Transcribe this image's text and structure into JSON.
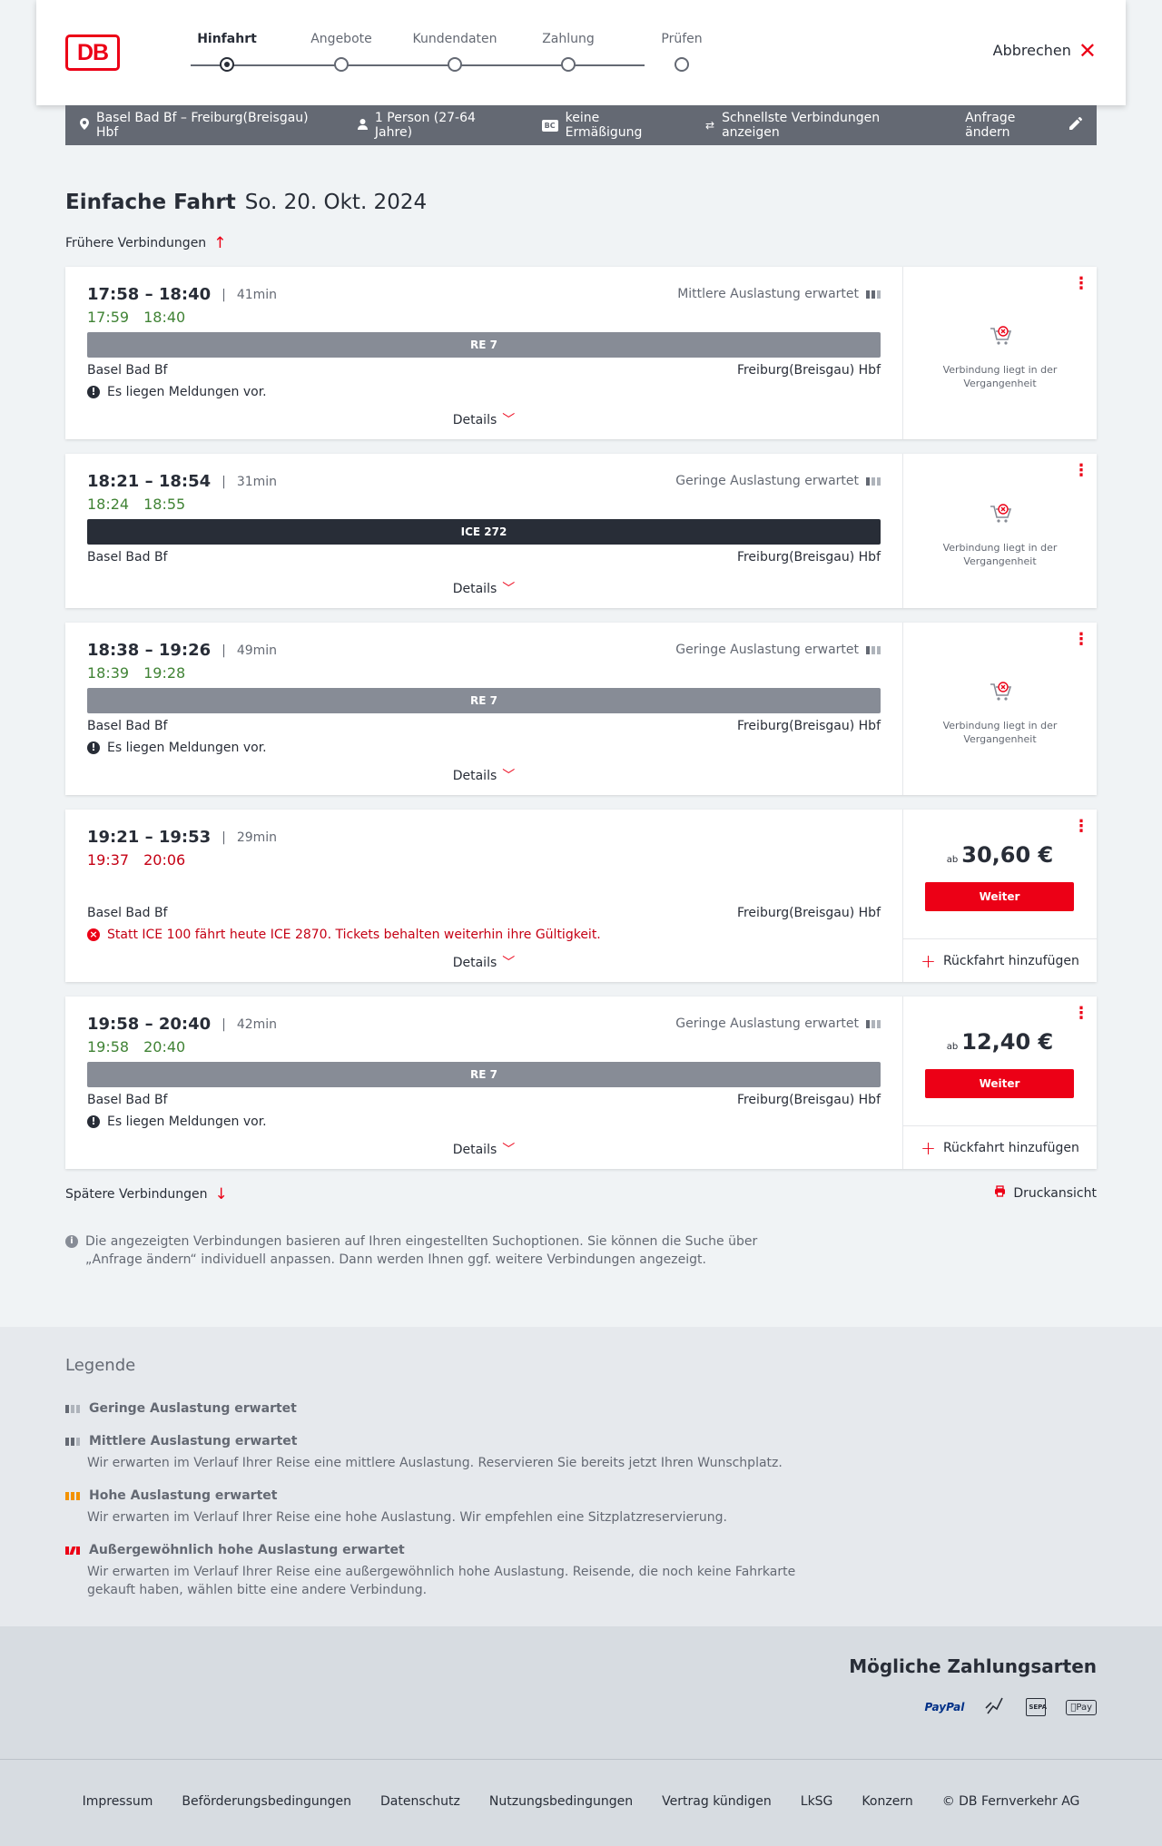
{
  "header": {
    "logo": "DB",
    "steps": [
      "Hinfahrt",
      "Angebote",
      "Kundendaten",
      "Zahlung",
      "Prüfen"
    ],
    "cancel_label": "Abbrechen"
  },
  "summary": {
    "route": "Basel Bad Bf – Freiburg(Breisgau) Hbf",
    "travellers": "1 Person (27-64 Jahre)",
    "discount": "keine Ermäßigung",
    "discount_badge": "BC",
    "fastest": "Schnellste Verbindungen anzeigen",
    "edit_label": "Anfrage ändern"
  },
  "page": {
    "title_strong": "Einfache Fahrt",
    "title_date": "So. 20. Okt. 2024",
    "earlier": "Frühere Verbindungen",
    "later": "Spätere Verbindungen",
    "print": "Druckansicht",
    "details_label": "Details",
    "past_text": "Verbindung liegt in der Vergangenheit",
    "from_prefix": "ab",
    "continue_label": "Weiter",
    "add_return": "Rückfahrt hinzufügen",
    "info": "Die angezeigten Verbindungen basieren auf Ihren eingestellten Suchoptionen. Sie können die Suche über „Anfrage ändern“ individuell anpassen. Dann werden Ihnen ggf. weitere Verbindungen angezeigt."
  },
  "connections": [
    {
      "times": "17:58 – 18:40",
      "duration": "41min",
      "rt_dep": "17:59",
      "rt_arr": "18:40",
      "rt_status": "green",
      "load": "Mittlere Auslastung erwartet",
      "load_level": 2,
      "train": "RE 7",
      "train_type": "re",
      "from": "Basel Bad Bf",
      "to": "Freiburg(Breisgau) Hbf",
      "message": "Es liegen Meldungen vor.",
      "message_type": "info",
      "offer": "past"
    },
    {
      "times": "18:21 – 18:54",
      "duration": "31min",
      "rt_dep": "18:24",
      "rt_arr": "18:55",
      "rt_status": "green",
      "load": "Geringe Auslastung erwartet",
      "load_level": 1,
      "train": "ICE 272",
      "train_type": "ice",
      "from": "Basel Bad Bf",
      "to": "Freiburg(Breisgau) Hbf",
      "message": "",
      "message_type": "",
      "offer": "past"
    },
    {
      "times": "18:38 – 19:26",
      "duration": "49min",
      "rt_dep": "18:39",
      "rt_arr": "19:28",
      "rt_status": "green",
      "load": "Geringe Auslastung erwartet",
      "load_level": 1,
      "train": "RE 7",
      "train_type": "re",
      "from": "Basel Bad Bf",
      "to": "Freiburg(Breisgau) Hbf",
      "message": "Es liegen Meldungen vor.",
      "message_type": "info",
      "offer": "past"
    },
    {
      "times": "19:21 – 19:53",
      "duration": "29min",
      "rt_dep": "19:37",
      "rt_arr": "20:06",
      "rt_status": "red",
      "load": "",
      "load_level": 0,
      "train": "",
      "train_type": "",
      "from": "Basel Bad Bf",
      "to": "Freiburg(Breisgau) Hbf",
      "message": "Statt ICE 100 fährt heute ICE 2870. Tickets behalten weiterhin ihre Gültigkeit.",
      "message_type": "error",
      "offer": "price",
      "price": "30,60 €"
    },
    {
      "times": "19:58 – 20:40",
      "duration": "42min",
      "rt_dep": "19:58",
      "rt_arr": "20:40",
      "rt_status": "green",
      "load": "Geringe Auslastung erwartet",
      "load_level": 1,
      "train": "RE 7",
      "train_type": "re",
      "from": "Basel Bad Bf",
      "to": "Freiburg(Breisgau) Hbf",
      "message": "Es liegen Meldungen vor.",
      "message_type": "info",
      "offer": "price",
      "price": "12,40 €"
    }
  ],
  "legend": {
    "title": "Legende",
    "items": [
      {
        "title": "Geringe Auslastung erwartet",
        "desc": ""
      },
      {
        "title": "Mittlere Auslastung erwartet",
        "desc": "Wir erwarten im Verlauf Ihrer Reise eine mittlere Auslastung. Reservieren Sie bereits jetzt Ihren Wunschplatz."
      },
      {
        "title": "Hohe Auslastung erwartet",
        "desc": "Wir erwarten im Verlauf Ihrer Reise eine hohe Auslastung. Wir empfehlen eine Sitzplatzreservierung."
      },
      {
        "title": "Außergewöhnlich hohe Auslastung erwartet",
        "desc": "Wir erwarten im Verlauf Ihrer Reise eine außergewöhnlich hohe Auslastung. Reisende, die noch keine Fahrkarte gekauft haben, wählen bitte eine andere Verbindung."
      }
    ]
  },
  "payment": {
    "title": "Mögliche Zahlungsarten",
    "paypal": "PayPal",
    "sepa": "SEPA",
    "applepay": "Pay"
  },
  "footer": {
    "links": [
      "Impressum",
      "Beförderungsbedingungen",
      "Datenschutz",
      "Nutzungsbedingungen",
      "Vertrag kündigen",
      "LkSG",
      "Konzern",
      "© DB Fernverkehr AG"
    ]
  },
  "colors": {
    "brand": "#ec0016",
    "ontime": "#408335",
    "delayed": "#c50014",
    "summary_bg": "#646973"
  }
}
